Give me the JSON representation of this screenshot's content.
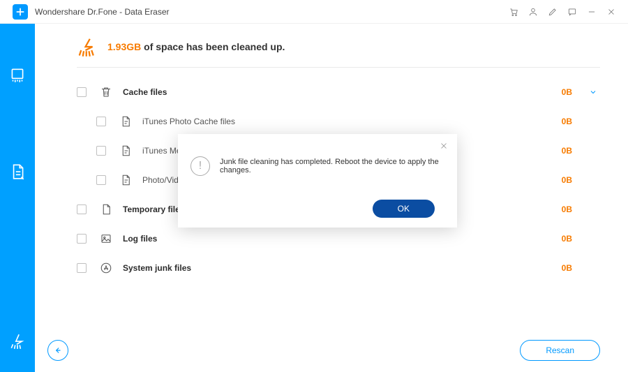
{
  "window": {
    "title": "Wondershare Dr.Fone - Data Eraser"
  },
  "summary": {
    "amount": "1.93GB",
    "suffix": " of space has been cleaned up."
  },
  "categories": [
    {
      "name": "Cache files",
      "size": "0B",
      "expanded": true,
      "items": [
        {
          "name": "iTunes Photo Cache files",
          "size": "0B"
        },
        {
          "name": "iTunes Media Cache files",
          "size": "0B"
        },
        {
          "name": "Photo/Video Cache files",
          "size": "0B"
        }
      ]
    },
    {
      "name": "Temporary files",
      "size": "0B"
    },
    {
      "name": "Log files",
      "size": "0B"
    },
    {
      "name": "System junk files",
      "size": "0B"
    }
  ],
  "modal": {
    "message": "Junk file cleaning has completed. Reboot the device to apply the changes.",
    "ok": "OK"
  },
  "footer": {
    "rescan": "Rescan"
  }
}
